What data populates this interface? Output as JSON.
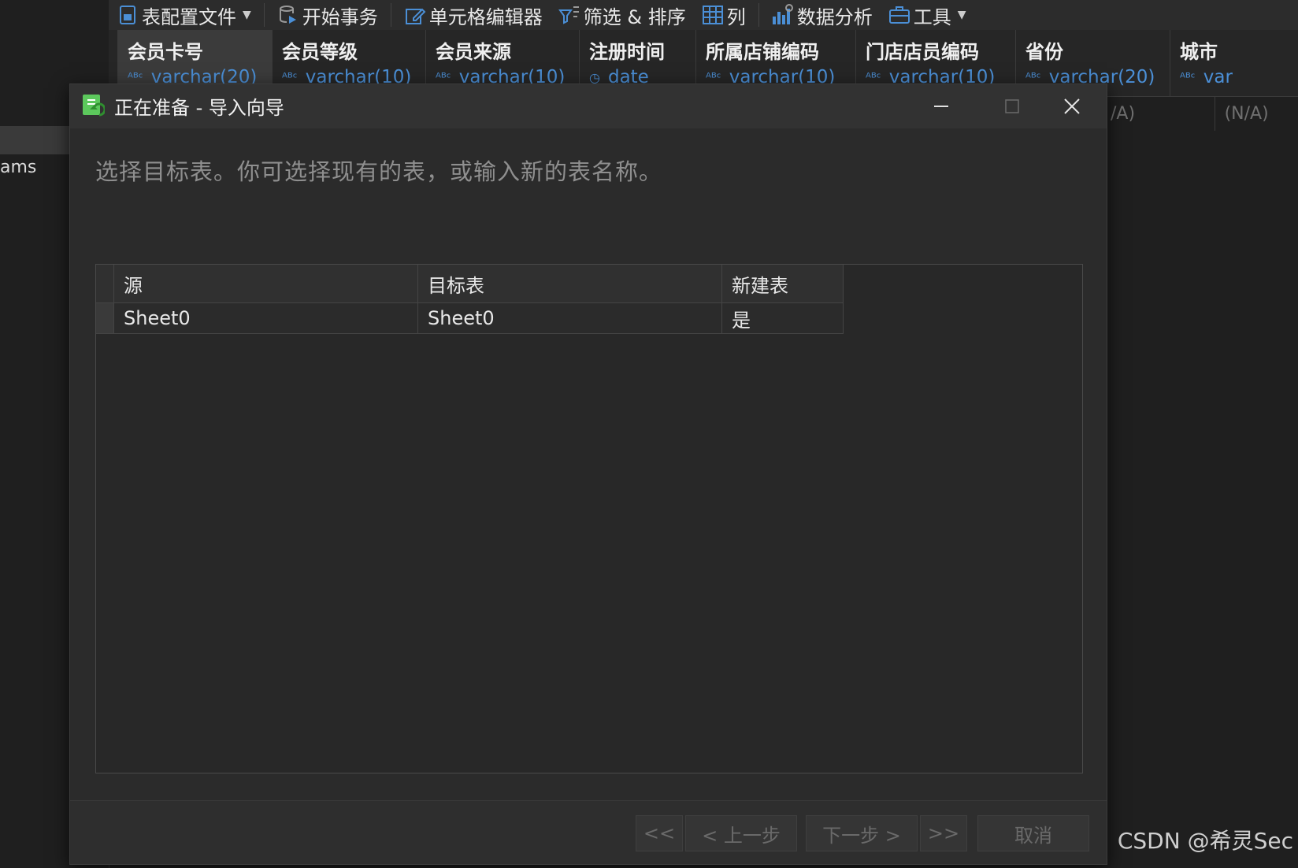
{
  "toolbar": {
    "items": [
      {
        "label": "表配置文件",
        "icon": "table-profile-icon",
        "dropdown": true
      },
      {
        "label": "开始事务",
        "icon": "begin-transaction-icon"
      },
      {
        "label": "单元格编辑器",
        "icon": "cell-editor-icon"
      },
      {
        "label": "筛选 & 排序",
        "icon": "filter-sort-icon"
      },
      {
        "label": "列",
        "icon": "columns-icon"
      },
      {
        "label": "数据分析",
        "icon": "data-analysis-icon"
      },
      {
        "label": "工具",
        "icon": "tools-icon",
        "dropdown": true
      }
    ]
  },
  "left_panel": {
    "partial_text": "ams"
  },
  "grid": {
    "columns": [
      {
        "name": "会员卡号",
        "type": "varchar(20)"
      },
      {
        "name": "会员等级",
        "type": "varchar(10)"
      },
      {
        "name": "会员来源",
        "type": "varchar(10)"
      },
      {
        "name": "注册时间",
        "type": "date"
      },
      {
        "name": "所属店铺编码",
        "type": "varchar(10)"
      },
      {
        "name": "门店店员编码",
        "type": "varchar(10)"
      },
      {
        "name": "省份",
        "type": "varchar(20)"
      },
      {
        "name": "城市",
        "type": "var"
      }
    ],
    "row_values": [
      "/A)",
      "(N/A)"
    ]
  },
  "dialog": {
    "title": "正在准备 - 导入向导",
    "instruction": "选择目标表。你可选择现有的表，或输入新的表名称。",
    "table": {
      "headers": [
        "源",
        "目标表",
        "新建表"
      ],
      "rows": [
        {
          "source": "Sheet0",
          "target": "Sheet0",
          "new_table": "是"
        }
      ]
    },
    "buttons": {
      "first": "<<",
      "prev": "< 上一步",
      "next": "下一步 >",
      "last": ">>",
      "cancel": "取消"
    }
  },
  "watermark": "CSDN @希灵Sec",
  "colors": {
    "background": "#1f1f1f",
    "dialog": "#2b2b2b",
    "type_text": "#4b8fd6",
    "app_icon": "#5cc85c"
  }
}
